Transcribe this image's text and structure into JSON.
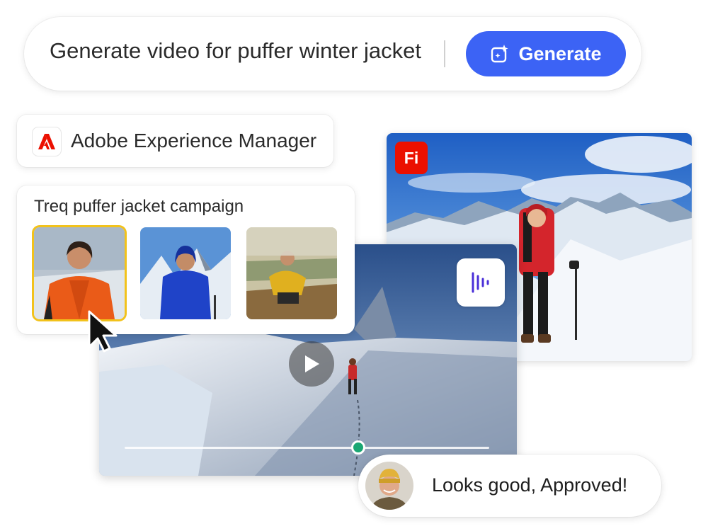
{
  "prompt": {
    "text": "Generate video for puffer winter jacket",
    "generate_label": "Generate",
    "generate_icon": "sparkle-magic-icon"
  },
  "aem": {
    "label": "Adobe Experience Manager",
    "logo": "adobe-logo-icon"
  },
  "campaign": {
    "title": "Treq puffer jacket campaign",
    "thumbnails": [
      {
        "subject": "woman in orange puffer jacket",
        "selected": true
      },
      {
        "subject": "woman in blue puffer jacket on snowy mountain",
        "selected": false
      },
      {
        "subject": "man in yellow puffer jacket kneeling on hill",
        "selected": false
      }
    ]
  },
  "firefly": {
    "badge": "Fi",
    "image": "hiker in red jacket on snowy mountain"
  },
  "video": {
    "audio_icon": "audio-waveform-icon",
    "play_icon": "play-icon",
    "progress": 0.64
  },
  "comment": {
    "text": "Looks good, Approved!",
    "avatar": "man-in-yellow-beanie-avatar"
  },
  "colors": {
    "accent": "#3c63f5",
    "adobe_red": "#eb1000",
    "selection": "#f2c21b",
    "scrubber": "#1aa673"
  }
}
